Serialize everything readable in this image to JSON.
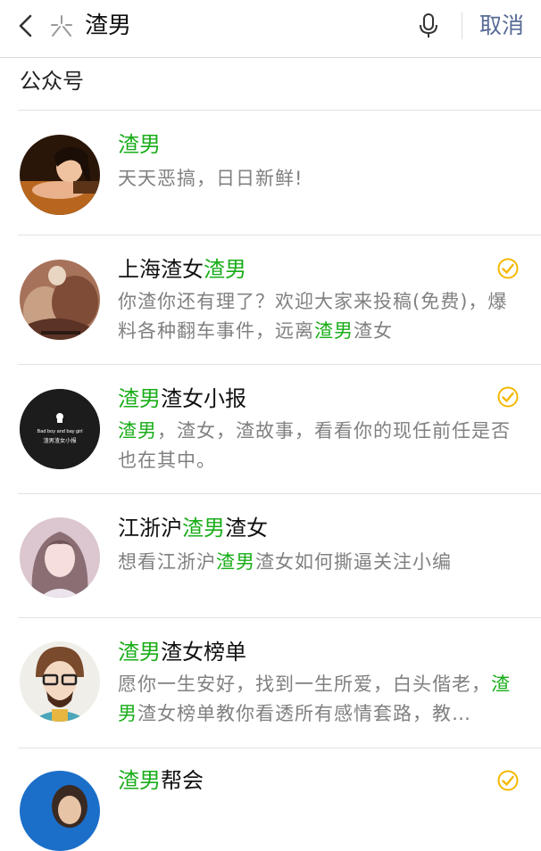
{
  "search": {
    "query": "渣男",
    "cancel_label": "取消"
  },
  "section_title": "公众号",
  "results": [
    {
      "name": [
        {
          "t": "渣男",
          "hl": true
        }
      ],
      "desc": [
        {
          "t": "天天恶搞，日日新鲜!",
          "hl": false
        }
      ],
      "verified": false
    },
    {
      "name": [
        {
          "t": "上海渣女",
          "hl": false
        },
        {
          "t": "渣男",
          "hl": true
        }
      ],
      "desc": [
        {
          "t": "你渣你还有理了？欢迎大家来投稿(免费)，爆料各种翻车事件，远离",
          "hl": false
        },
        {
          "t": "渣男",
          "hl": true
        },
        {
          "t": "渣女",
          "hl": false
        }
      ],
      "verified": true
    },
    {
      "name": [
        {
          "t": "渣男",
          "hl": true
        },
        {
          "t": "渣女小报",
          "hl": false
        }
      ],
      "desc": [
        {
          "t": "渣男",
          "hl": true
        },
        {
          "t": "，渣女，渣故事，看看你的现任前任是否也在其中。",
          "hl": false
        }
      ],
      "verified": true,
      "avatar_text_en": "Bad boy and bay girl",
      "avatar_text_cn": "渣男渣女小报"
    },
    {
      "name": [
        {
          "t": "江浙沪",
          "hl": false
        },
        {
          "t": "渣男",
          "hl": true
        },
        {
          "t": "渣女",
          "hl": false
        }
      ],
      "desc": [
        {
          "t": "想看江浙沪",
          "hl": false
        },
        {
          "t": "渣男",
          "hl": true
        },
        {
          "t": "渣女如何撕逼关注小编",
          "hl": false
        }
      ],
      "verified": false
    },
    {
      "name": [
        {
          "t": "渣男",
          "hl": true
        },
        {
          "t": "渣女榜单",
          "hl": false
        }
      ],
      "desc": [
        {
          "t": "愿你一生安好，找到一生所爱，白头偕老，",
          "hl": false
        },
        {
          "t": "渣男",
          "hl": true
        },
        {
          "t": "渣女榜单教你看透所有感情套路，教…",
          "hl": false
        }
      ],
      "verified": false
    },
    {
      "name": [
        {
          "t": "渣男",
          "hl": true
        },
        {
          "t": "帮会",
          "hl": false
        }
      ],
      "desc": [],
      "verified": true
    }
  ],
  "colors": {
    "highlight": "#1aad19",
    "verified_badge": "#f5b800",
    "cancel_link": "#576b95",
    "desc_gray": "#808080"
  },
  "icons": {
    "back": "chevron-left-icon",
    "search_type": "official-account-icon",
    "mic": "microphone-icon",
    "verified": "verified-check-icon"
  }
}
